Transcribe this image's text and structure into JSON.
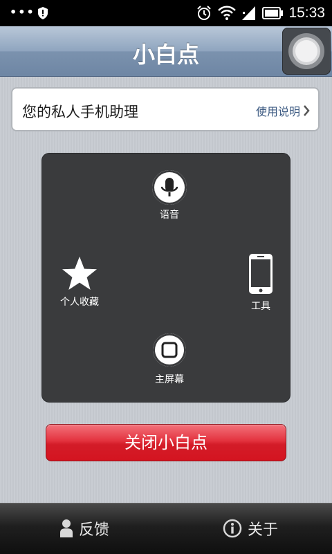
{
  "status_bar": {
    "dots": "•••",
    "time": "15:33"
  },
  "title_bar": {
    "title": "小白点"
  },
  "info_card": {
    "text": "您的私人手机助理",
    "link_label": "使用说明"
  },
  "panel": {
    "voice_label": "语音",
    "favorites_label": "个人收藏",
    "tools_label": "工具",
    "home_label": "主屏幕"
  },
  "close_button": {
    "label": "关闭小白点"
  },
  "bottom_bar": {
    "feedback_label": "反馈",
    "about_label": "关于"
  },
  "colors": {
    "title_bar_accent": "#7b92ae",
    "close_button_red": "#d31c28",
    "panel_bg": "#3a3b3d",
    "link_blue": "#3c5a82"
  }
}
